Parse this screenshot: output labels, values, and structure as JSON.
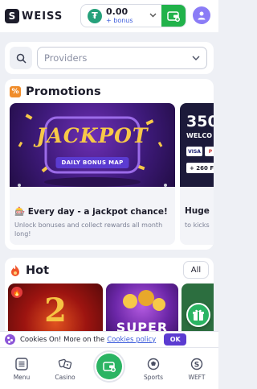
{
  "header": {
    "logo_letter": "S",
    "logo_text": "WEISS",
    "balance_amount": "0.00",
    "balance_bonus": "+ bonus",
    "currency_icon": "tether-icon",
    "wallet_icon": "wallet-icon",
    "avatar_icon": "user-icon"
  },
  "search": {
    "placeholder": "Providers",
    "search_icon": "search-icon"
  },
  "promotions": {
    "title": "Promotions",
    "items": [
      {
        "art_title": "JACKPOT",
        "art_tag": "DAILY BONUS MAP",
        "title": "🎰 Every day - a jackpot chance!",
        "description": "Unlock bonuses and collect rewards all month long!"
      },
      {
        "art_title": "350",
        "art_subtitle": "WELCO",
        "art_chips": [
          "VISA",
          "P"
        ],
        "art_plus": "+ 260 F",
        "title": "Huge",
        "description": "to kicks"
      }
    ]
  },
  "hot": {
    "title": "Hot",
    "all_label": "All",
    "games": [
      {
        "label": "2"
      },
      {
        "label": "SUPER"
      },
      {
        "label": ""
      }
    ]
  },
  "cookie": {
    "text": "Cookies On! More on the",
    "link": "Cookies policy",
    "ok_label": "OK"
  },
  "bottom_nav": {
    "items": [
      {
        "label": "Menu",
        "icon": "menu-icon"
      },
      {
        "label": "Casino",
        "icon": "casino-icon"
      },
      {
        "label": "Sports",
        "icon": "sports-icon"
      },
      {
        "label": "WEFT",
        "icon": "weft-icon"
      }
    ],
    "center_icon": "deposit-icon"
  },
  "colors": {
    "accent_green": "#21b24a",
    "accent_purple": "#5b3bd1",
    "link_blue": "#3b5bdb",
    "promo_orange": "#f08c2a",
    "hot_red": "#f0542a"
  }
}
